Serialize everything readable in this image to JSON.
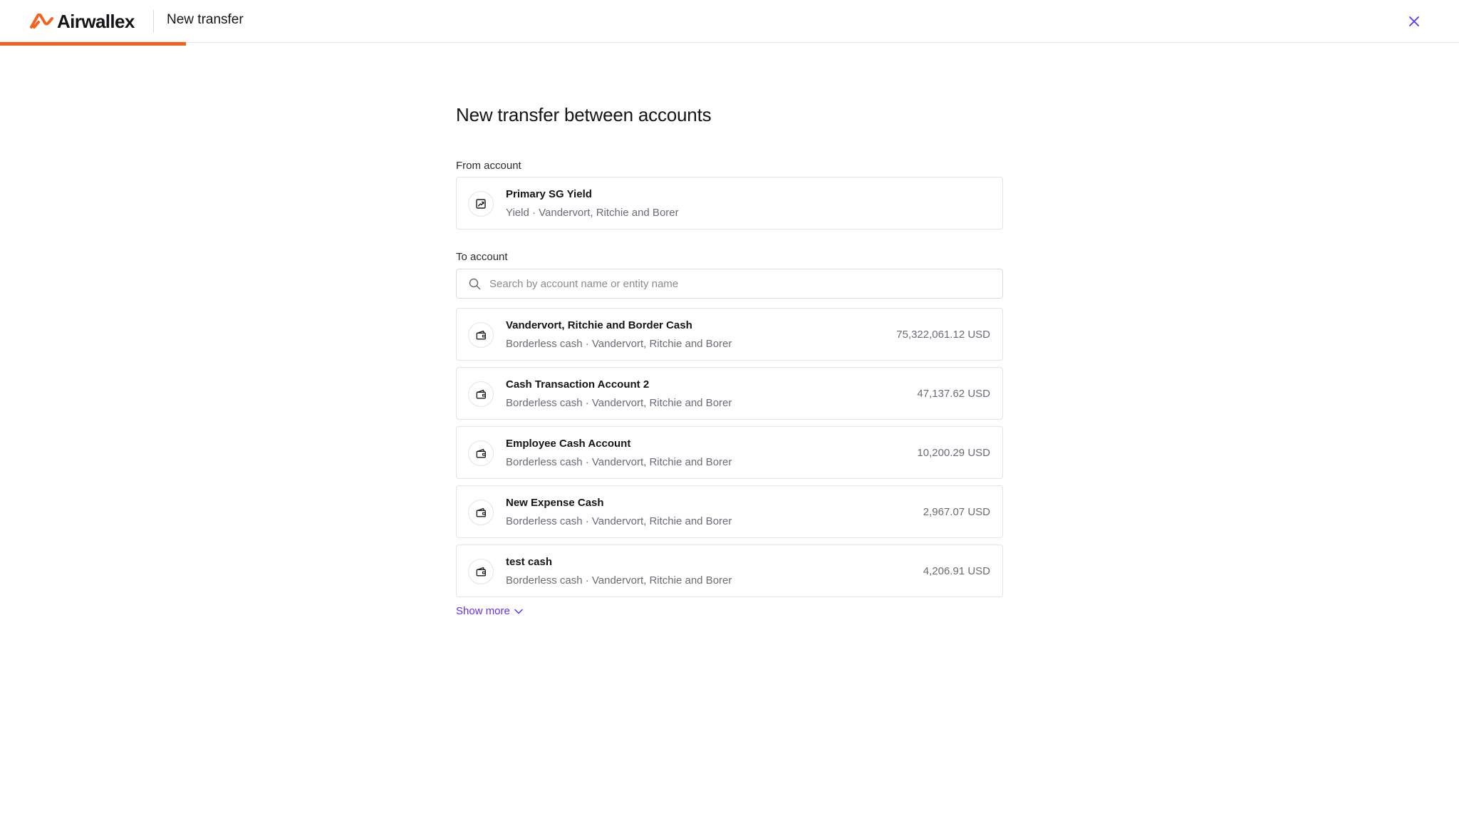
{
  "header": {
    "brand": "Airwallex",
    "page_label": "New transfer",
    "progress_fraction": 0.1274,
    "accent_color": "#f2631f",
    "close_icon": "close-icon"
  },
  "main": {
    "heading": "New transfer between accounts",
    "from_label": "From account",
    "from_account": {
      "title": "Primary SG Yield",
      "subtitle": "Yield · Vandervort, Ritchie and Borer",
      "icon": "yield-chart-icon"
    },
    "to_label": "To account",
    "search": {
      "placeholder": "Search by account name or entity name",
      "value": ""
    },
    "accounts": [
      {
        "title": "Vandervort, Ritchie and Border Cash",
        "subtitle": "Borderless cash · Vandervort, Ritchie and Borer",
        "amount": "75,322,061.12 USD",
        "icon": "wallet-icon"
      },
      {
        "title": "Cash Transaction Account 2",
        "subtitle": "Borderless cash · Vandervort, Ritchie and Borer",
        "amount": "47,137.62 USD",
        "icon": "wallet-icon"
      },
      {
        "title": "Employee Cash Account",
        "subtitle": "Borderless cash · Vandervort, Ritchie and Borer",
        "amount": "10,200.29 USD",
        "icon": "wallet-icon"
      },
      {
        "title": "New Expense Cash",
        "subtitle": "Borderless cash · Vandervort, Ritchie and Borer",
        "amount": "2,967.07 USD",
        "icon": "wallet-icon"
      },
      {
        "title": "test cash",
        "subtitle": "Borderless cash · Vandervort, Ritchie and Borer",
        "amount": "4,206.91 USD",
        "icon": "wallet-icon"
      }
    ],
    "show_more": "Show more",
    "link_color": "#612fff"
  }
}
